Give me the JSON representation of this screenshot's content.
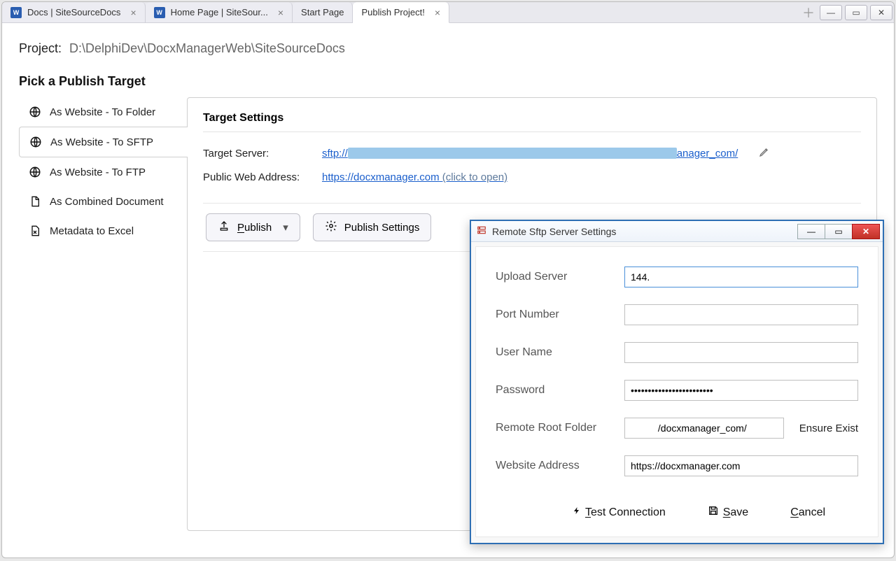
{
  "tabs": {
    "t0": "Docs | SiteSourceDocs",
    "t1": "Home Page | SiteSour...",
    "t2": "Start Page",
    "t3": "Publish Project!"
  },
  "project": {
    "label": "Project:",
    "path": "D:\\DelphiDev\\DocxManagerWeb\\SiteSourceDocs"
  },
  "heading": "Pick a Publish Target",
  "nav": {
    "n0": "As Website - To Folder",
    "n1": "As Website - To SFTP",
    "n2": "As Website - To FTP",
    "n3": "As Combined Document",
    "n4": "Metadata to Excel"
  },
  "panel": {
    "title": "Target Settings",
    "target_server_label": "Target Server:",
    "target_server_prefix": "sftp://",
    "target_server_suffix": "anager_com/",
    "public_web_label": "Public Web Address:",
    "public_web_url": "https://docxmanager.com",
    "click_to_open": " (click to open)",
    "btn_publish": "Publish",
    "btn_publish_settings": "Publish Settings"
  },
  "dialog": {
    "title": "Remote Sftp Server Settings",
    "upload_server_label": "Upload Server",
    "upload_server_value": "144.",
    "port_label": "Port Number",
    "port_value": "",
    "user_label": "User Name",
    "user_value": "",
    "password_label": "Password",
    "password_value": "************************",
    "root_label": "Remote Root Folder",
    "root_value": "          /docxmanager_com/",
    "ensure_exist": "Ensure Exist",
    "website_label": "Website Address",
    "website_value": "https://docxmanager.com",
    "test_connection": "Test Connection",
    "save": "Save",
    "cancel": "Cancel"
  }
}
